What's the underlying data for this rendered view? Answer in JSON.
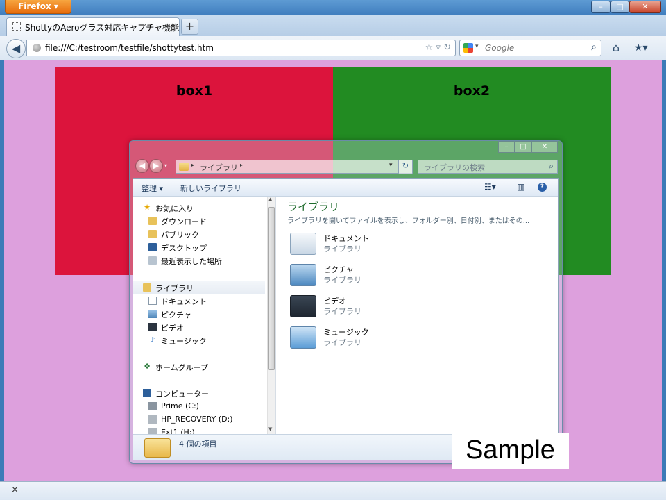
{
  "browser": {
    "app_button_label": "Firefox ▾",
    "tab_title": "ShottyのAeroグラス対応キャプチャ機能",
    "new_tab_label": "+",
    "back_label": "◀",
    "url": "file:///C:/testroom/testfile/shottytest.htm",
    "search_placeholder": "Google",
    "window_controls": [
      "–",
      "□",
      "✕"
    ],
    "findbar_close": "×"
  },
  "page": {
    "background": "#dda0dd",
    "box1": {
      "label": "box1",
      "color": "#dc143c"
    },
    "box2": {
      "label": "box2",
      "color": "#228b22"
    },
    "sample_label": "Sample"
  },
  "explorer": {
    "window_controls": [
      "–",
      "□",
      "✕"
    ],
    "address": "ライブラリ",
    "search_placeholder": "ライブラリの検索",
    "toolbar": {
      "organize": "整理 ▾",
      "new_library": "新しいライブラリ"
    },
    "nav": {
      "favorites": "お気に入り",
      "downloads": "ダウンロード",
      "public": "パブリック",
      "desktop": "デスクトップ",
      "recent": "最近表示した場所",
      "libraries": "ライブラリ",
      "documents": "ドキュメント",
      "pictures": "ピクチャ",
      "videos": "ビデオ",
      "music": "ミュージック",
      "homegroup": "ホームグループ",
      "computer": "コンピューター",
      "drive_c": "Prime (C:)",
      "drive_d": "HP_RECOVERY (D:)",
      "drive_h": "Ext1 (H:)"
    },
    "content": {
      "title": "ライブラリ",
      "description": "ライブラリを開いてファイルを表示し、フォルダー別、日付別、またはその...",
      "items": [
        {
          "name": "ドキュメント",
          "sub": "ライブラリ"
        },
        {
          "name": "ピクチャ",
          "sub": "ライブラリ"
        },
        {
          "name": "ビデオ",
          "sub": "ライブラリ"
        },
        {
          "name": "ミュージック",
          "sub": "ライブラリ"
        }
      ]
    },
    "status": "4 個の項目"
  }
}
